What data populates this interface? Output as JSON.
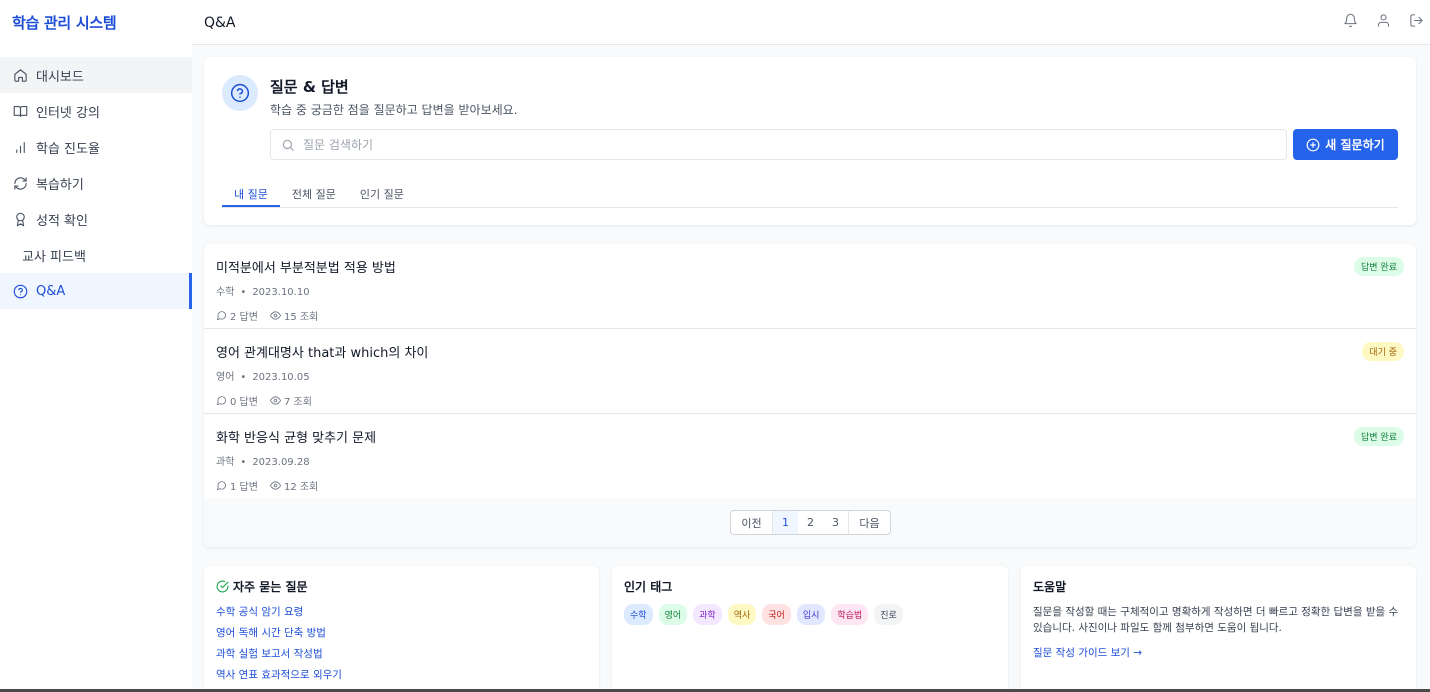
{
  "app": {
    "title": "학습 관리 시스템"
  },
  "sidebar": {
    "items": [
      {
        "label": "대시보드",
        "icon": "home-icon"
      },
      {
        "label": "인터넷 강의",
        "icon": "book-icon"
      },
      {
        "label": "학습 진도율",
        "icon": "bar-chart-icon"
      },
      {
        "label": "복습하기",
        "icon": "refresh-icon"
      },
      {
        "label": "성적 확인",
        "icon": "award-icon"
      },
      {
        "label": "교사 피드백",
        "icon": ""
      },
      {
        "label": "Q&A",
        "icon": "help-circle-icon",
        "active": true
      }
    ]
  },
  "header": {
    "title": "Q&A",
    "icons": [
      "bell-icon",
      "user-icon",
      "logout-icon"
    ]
  },
  "hero": {
    "title": "질문 & 답변",
    "subtitle": "학습 중 궁금한 점을 질문하고 답변을 받아보세요.",
    "search_placeholder": "질문 검색하기",
    "new_button": "새 질문하기",
    "tabs": [
      "내 질문",
      "전체 질문",
      "인기 질문"
    ],
    "active_tab": 0
  },
  "questions": [
    {
      "title": "미적분에서 부분적분법 적용 방법",
      "subject": "수학",
      "date": "2023.10.10",
      "answers": "2 답변",
      "views": "15 조회",
      "status": "답변 완료"
    },
    {
      "title": "영어 관계대명사 that과 which의 차이",
      "subject": "영어",
      "date": "2023.10.05",
      "answers": "0 답변",
      "views": "7 조회",
      "status": "대기 중"
    },
    {
      "title": "화학 반응식 균형 맞추기 문제",
      "subject": "과학",
      "date": "2023.09.28",
      "answers": "1 답변",
      "views": "12 조회",
      "status": "답변 완료"
    }
  ],
  "pagination": {
    "prev": "이전",
    "pages": [
      "1",
      "2",
      "3"
    ],
    "current": "1",
    "next": "다음"
  },
  "faq": {
    "title": "자주 묻는 질문",
    "items": [
      "수학 공식 암기 요령",
      "영어 독해 시간 단축 방법",
      "과학 실험 보고서 작성법",
      "역사 연표 효과적으로 외우기"
    ]
  },
  "tags": {
    "title": "인기 태그",
    "items": [
      {
        "label": "수학",
        "bg": "#dbeafe",
        "fg": "#1d4ed8"
      },
      {
        "label": "영어",
        "bg": "#dcfce7",
        "fg": "#15803d"
      },
      {
        "label": "과학",
        "bg": "#f3e8ff",
        "fg": "#7e22ce"
      },
      {
        "label": "역사",
        "bg": "#fef9c3",
        "fg": "#a16207"
      },
      {
        "label": "국어",
        "bg": "#fee2e2",
        "fg": "#b91c1c"
      },
      {
        "label": "입시",
        "bg": "#e0e7ff",
        "fg": "#4338ca"
      },
      {
        "label": "학습법",
        "bg": "#fce7f3",
        "fg": "#be185d"
      },
      {
        "label": "진로",
        "bg": "#f3f4f6",
        "fg": "#374151"
      }
    ]
  },
  "help": {
    "title": "도움말",
    "text": "질문을 작성할 때는 구체적이고 명확하게 작성하면 더 빠르고 정확한 답변을 받을 수 있습니다. 사진이나 파일도 함께 첨부하면 도움이 됩니다.",
    "link": "질문 작성 가이드 보기 →"
  },
  "colors": {
    "accent": "#2563eb",
    "brand": "#1d4ed8",
    "done": "#15803d",
    "waiting": "#a16207"
  }
}
